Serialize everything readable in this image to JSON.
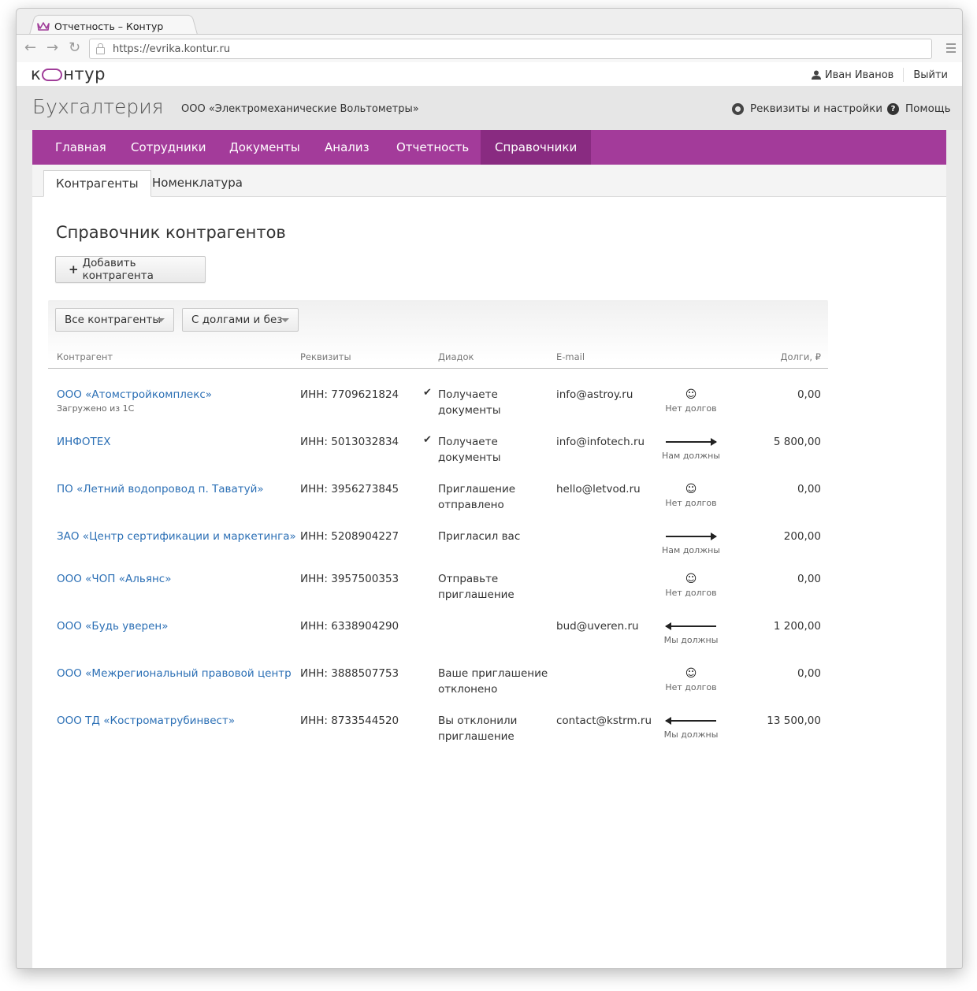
{
  "browser": {
    "tab_title": "Отчетность – Контур",
    "url": "https://evrika.kontur.ru"
  },
  "topbar": {
    "logo": {
      "before": "к",
      "after": "нтур"
    },
    "user_name": "Иван Иванов",
    "logout": "Выйти"
  },
  "app": {
    "title": "Бухгалтерия",
    "org": "ООО «Электромеханические Вольтометры»",
    "settings": "Реквизиты и настройки",
    "help": "Помощь"
  },
  "nav": {
    "items": [
      "Главная",
      "Сотрудники",
      "Документы",
      "Анализ",
      "Отчетность",
      "Справочники"
    ],
    "active": "Справочники"
  },
  "subtabs": {
    "items": [
      "Контрагенты",
      "Номенклатура"
    ],
    "active": "Контрагенты"
  },
  "page": {
    "title": "Справочник контрагентов",
    "add_button": "Добавить контрагента"
  },
  "filters": {
    "type": "Все контрагенты",
    "debts": "С долгами и без"
  },
  "table": {
    "headers": {
      "name": "Контрагент",
      "requisites": "Реквизиты",
      "diadoc": "Диадок",
      "email": "E-mail",
      "debts": "Долги, ₽"
    },
    "rows": [
      {
        "name": "ООО «Атомстройкомплекс»",
        "note": "Загружено из 1С",
        "inn": "ИНН: 7709621824",
        "check": true,
        "diadoc": "Получаете документы",
        "email": "info@astroy.ru",
        "debt_icon": "smiley-icon",
        "debt_status": "Нет долгов",
        "amount": "0,00"
      },
      {
        "name": "ИНФОТЕХ",
        "note": "",
        "inn": "ИНН: 5013032834",
        "check": true,
        "diadoc": "Получаете документы",
        "email": "info@infotech.ru",
        "debt_icon": "arrow-right-icon",
        "debt_status": "Нам должны",
        "amount": "5 800,00"
      },
      {
        "name": "ПО «Летний водопровод п. Таватуй»",
        "note": "",
        "inn": "ИНН: 3956273845",
        "check": false,
        "diadoc": "Приглашение отправлено",
        "email": "hello@letvod.ru",
        "debt_icon": "smiley-icon",
        "debt_status": "Нет долгов",
        "amount": "0,00"
      },
      {
        "name": "ЗАО «Центр сертификации и маркетинга»",
        "note": "",
        "inn": "ИНН: 5208904227",
        "check": false,
        "diadoc": "Пригласил вас",
        "email": "",
        "debt_icon": "arrow-right-icon",
        "debt_status": "Нам должны",
        "amount": "200,00"
      },
      {
        "name": "ООО «ЧОП «Альянс»",
        "note": "",
        "inn": "ИНН: 3957500353",
        "check": false,
        "diadoc": "Отправьте приглашение",
        "email": "",
        "debt_icon": "smiley-icon",
        "debt_status": "Нет долгов",
        "amount": "0,00"
      },
      {
        "name": "ООО «Будь уверен»",
        "note": "",
        "inn": "ИНН: 6338904290",
        "check": false,
        "diadoc": "",
        "email": "bud@uveren.ru",
        "debt_icon": "arrow-left-icon",
        "debt_status": "Мы должны",
        "amount": "1 200,00"
      },
      {
        "name": "ООО «Межрегиональный правовой центр",
        "note": "",
        "inn": "ИНН: 3888507753",
        "check": false,
        "diadoc": "Ваше приглашение отклонено",
        "email": "",
        "debt_icon": "smiley-icon",
        "debt_status": "Нет долгов",
        "amount": "0,00"
      },
      {
        "name": "ООО ТД «Костроматрубинвест»",
        "note": "",
        "inn": "ИНН: 8733544520",
        "check": false,
        "diadoc": "Вы отклонили приглашение",
        "email": "contact@kstrm.ru",
        "debt_icon": "arrow-left-icon",
        "debt_status": "Мы должны",
        "amount": "13 500,00"
      }
    ]
  }
}
